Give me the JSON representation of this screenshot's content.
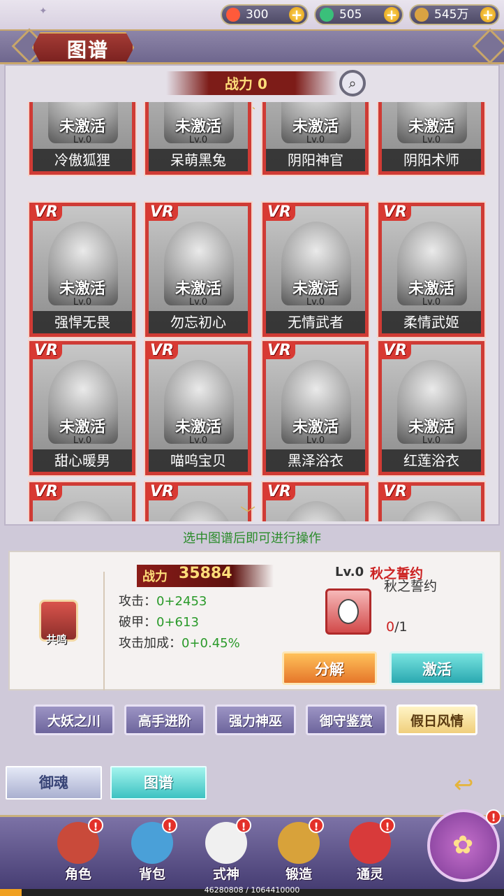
{
  "resources": [
    {
      "value": "300",
      "icon": "fire-icon",
      "color": "#ff5a3a"
    },
    {
      "value": "505",
      "icon": "jade-icon",
      "color": "#3ac07a"
    },
    {
      "value": "545万",
      "icon": "coin-icon",
      "color": "#d9a342"
    }
  ],
  "title": "图谱",
  "power_label": "战力 0",
  "cards": [
    {
      "name": "冷傲狐狸",
      "state": "未激活",
      "level": "Lv.0",
      "rarity": ""
    },
    {
      "name": "呆萌黑兔",
      "state": "未激活",
      "level": "Lv.0",
      "rarity": ""
    },
    {
      "name": "阴阳神官",
      "state": "未激活",
      "level": "Lv.0",
      "rarity": ""
    },
    {
      "name": "阴阳术师",
      "state": "未激活",
      "level": "Lv.0",
      "rarity": ""
    },
    {
      "name": "强悍无畏",
      "state": "未激活",
      "level": "Lv.0",
      "rarity": "VR"
    },
    {
      "name": "勿忘初心",
      "state": "未激活",
      "level": "Lv.0",
      "rarity": "VR"
    },
    {
      "name": "无情武者",
      "state": "未激活",
      "level": "Lv.0",
      "rarity": "VR"
    },
    {
      "name": "柔情武姬",
      "state": "未激活",
      "level": "Lv.0",
      "rarity": "VR"
    },
    {
      "name": "甜心暖男",
      "state": "未激活",
      "level": "Lv.0",
      "rarity": "VR"
    },
    {
      "name": "喵呜宝贝",
      "state": "未激活",
      "level": "Lv.0",
      "rarity": "VR"
    },
    {
      "name": "黑泽浴衣",
      "state": "未激活",
      "level": "Lv.0",
      "rarity": "VR"
    },
    {
      "name": "红莲浴衣",
      "state": "未激活",
      "level": "Lv.0",
      "rarity": "VR"
    },
    {
      "name": "",
      "state": "",
      "level": "",
      "rarity": "VR"
    },
    {
      "name": "",
      "state": "",
      "level": "",
      "rarity": "VR"
    },
    {
      "name": "",
      "state": "",
      "level": "",
      "rarity": "VR"
    },
    {
      "name": "",
      "state": "",
      "level": "",
      "rarity": "VR"
    }
  ],
  "hint": "选中图谱后即可进行操作",
  "detail": {
    "resonance_label": "共鸣",
    "cp_label": "战力",
    "cp_value": "35884",
    "stats": [
      {
        "label": "攻击：",
        "value": "0+2453"
      },
      {
        "label": "破甲：",
        "value": "0+613"
      },
      {
        "label": "攻击加成：",
        "value": "0+0.45%"
      }
    ],
    "set_level": "Lv.0",
    "set_name": "秋之誓约",
    "item_name": "秋之誓约",
    "item_have": "0",
    "item_need": "/1",
    "decompose_label": "分解",
    "activate_label": "激活"
  },
  "filters": [
    {
      "label": "大妖之川",
      "active": false
    },
    {
      "label": "高手进阶",
      "active": false
    },
    {
      "label": "强力神巫",
      "active": false
    },
    {
      "label": "御守鉴赏",
      "active": false
    },
    {
      "label": "假日风情",
      "active": true
    }
  ],
  "subtabs": [
    "御魂",
    "图谱"
  ],
  "nav": [
    {
      "label": "角色",
      "icon": "helmet-icon",
      "color": "#c94a3a"
    },
    {
      "label": "背包",
      "icon": "bag-icon",
      "color": "#4aa0d8"
    },
    {
      "label": "式神",
      "icon": "fox-mask-icon",
      "color": "#f0f0f0"
    },
    {
      "label": "锻造",
      "icon": "forge-icon",
      "color": "#d8a23a"
    },
    {
      "label": "通灵",
      "icon": "dragon-icon",
      "color": "#d83a3a"
    }
  ],
  "badge": "!",
  "exp": {
    "text": "46280808 / 1064410000",
    "fraction": 0.0435
  }
}
